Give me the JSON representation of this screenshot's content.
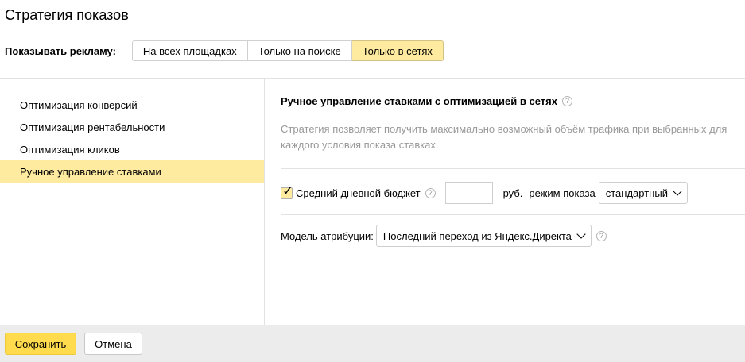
{
  "title": "Стратегия показов",
  "show_ads": {
    "label": "Показывать рекламу:",
    "options": [
      "На всех площадках",
      "Только на поиске",
      "Только в сетях"
    ],
    "selected_index": 2
  },
  "strategies": {
    "items": [
      "Оптимизация конверсий",
      "Оптимизация рентабельности",
      "Оптимизация кликов",
      "Ручное управление ставками"
    ],
    "selected_index": 3
  },
  "detail": {
    "heading": "Ручное управление ставками с оптимизацией в сетях",
    "help_icon": "?",
    "description": "Стратегия позволяет получить максимально возможный объём трафика при выбранных для каждого условия показа ставках.",
    "budget": {
      "checked": true,
      "label": "Средний дневной бюджет",
      "value": "",
      "currency": "руб.",
      "mode_label": "режим показа",
      "mode_value": "стандартный"
    },
    "attribution": {
      "label": "Модель атрибуции:",
      "value": "Последний переход из Яндекс.Директа"
    }
  },
  "footer": {
    "save_label": "Сохранить",
    "cancel_label": "Отмена"
  },
  "colors": {
    "accent_yellow": "#ffdb4d",
    "selected_bg": "#ffeba0"
  }
}
